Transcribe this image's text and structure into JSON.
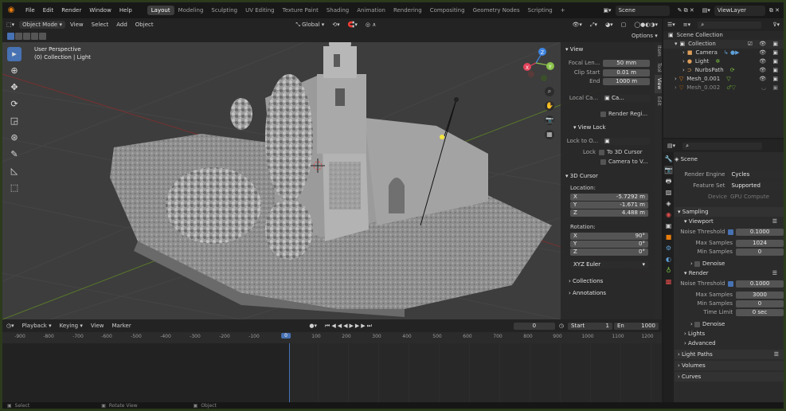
{
  "topbar": {
    "menus": [
      "File",
      "Edit",
      "Render",
      "Window",
      "Help"
    ],
    "workspaces": [
      "Layout",
      "Modeling",
      "Sculpting",
      "UV Editing",
      "Texture Paint",
      "Shading",
      "Animation",
      "Rendering",
      "Compositing",
      "Geometry Nodes",
      "Scripting"
    ],
    "active_workspace": "Layout",
    "scene": "Scene",
    "view_layer": "ViewLayer"
  },
  "viewport_header": {
    "mode": "Object Mode",
    "menus": [
      "View",
      "Select",
      "Add",
      "Object"
    ],
    "transform_orientation": "Global",
    "options": "Options"
  },
  "viewport": {
    "perspective": "User Perspective",
    "collection_info": "(0) Collection | Light"
  },
  "npanel": {
    "tabs": [
      "Item",
      "Tool",
      "View",
      "Edit"
    ],
    "active_tab": "View",
    "view": {
      "title": "View",
      "focal_label": "Focal Len...",
      "focal_value": "50 mm",
      "clip_start_label": "Clip Start",
      "clip_start_value": "0.01 m",
      "end_label": "End",
      "end_value": "1000 m",
      "local_camera_label": "Local Ca...",
      "local_camera_value": "Ca...",
      "render_region": "Render Regi..."
    },
    "view_lock": {
      "title": "View Lock",
      "lock_to_label": "Lock to O...",
      "lock_label": "Lock",
      "to_3d_cursor": "To 3D Cursor",
      "camera_to_view": "Camera to V..."
    },
    "cursor": {
      "title": "3D Cursor",
      "location_label": "Location:",
      "x": "-5.7292 m",
      "y": "-1.671 m",
      "z": "4.488 m",
      "rotation_label": "Rotation:",
      "rx": "90°",
      "ry": "0°",
      "rz": "0°",
      "mode": "XYZ Euler"
    },
    "collections": "Collections",
    "annotations": "Annotations"
  },
  "timeline": {
    "menus": [
      "Playback",
      "Keying",
      "View",
      "Marker"
    ],
    "current_frame": "0",
    "start_label": "Start",
    "start_value": "1",
    "end_label": "En",
    "end_value": "1000",
    "ticks": [
      "-900",
      "-800",
      "-700",
      "-600",
      "-500",
      "-400",
      "-300",
      "-200",
      "-100",
      "0",
      "100",
      "200",
      "300",
      "400",
      "500",
      "600",
      "700",
      "800",
      "900",
      "1000",
      "1100",
      "1200"
    ]
  },
  "statusbar": {
    "select": "Select",
    "rotate": "Rotate View",
    "object": "Object"
  },
  "outliner": {
    "scene_collection": "Scene Collection",
    "items": [
      {
        "name": "Collection",
        "level": 1,
        "color": "#c9c9c9"
      },
      {
        "name": "Camera",
        "level": 2,
        "color": "#d9d9d9"
      },
      {
        "name": "Light",
        "level": 2,
        "color": "#d9d9d9"
      },
      {
        "name": "NurbsPath",
        "level": 2,
        "color": "#d9d9d9"
      },
      {
        "name": "Mesh_0.001",
        "level": 1,
        "color": "#d9d9d9"
      },
      {
        "name": "Mesh_0.002",
        "level": 1,
        "color": "#8a8a8a"
      }
    ]
  },
  "properties": {
    "scene_name": "Scene",
    "render_engine_label": "Render Engine",
    "render_engine": "Cycles",
    "feature_set_label": "Feature Set",
    "feature_set": "Supported",
    "device_label": "Device",
    "device": "GPU Compute",
    "sampling": "Sampling",
    "viewport": "Viewport",
    "noise_threshold_label": "Noise Threshold",
    "vp_noise": "0.1000",
    "max_samples_label": "Max Samples",
    "vp_max": "1024",
    "min_samples_label": "Min Samples",
    "vp_min": "0",
    "denoise": "Denoise",
    "render": "Render",
    "r_noise": "0.1000",
    "r_max": "3000",
    "r_min": "0",
    "time_limit_label": "Time Limit",
    "time_limit": "0 sec",
    "lights": "Lights",
    "advanced": "Advanced",
    "light_paths": "Light Paths",
    "volumes": "Volumes",
    "curves": "Curves"
  },
  "colors": {
    "accent": "#4772b3",
    "orange": "#e87d0d",
    "gizmo_x": "#e2445c",
    "gizmo_y": "#8bc34a",
    "gizmo_z": "#3f86e2"
  }
}
